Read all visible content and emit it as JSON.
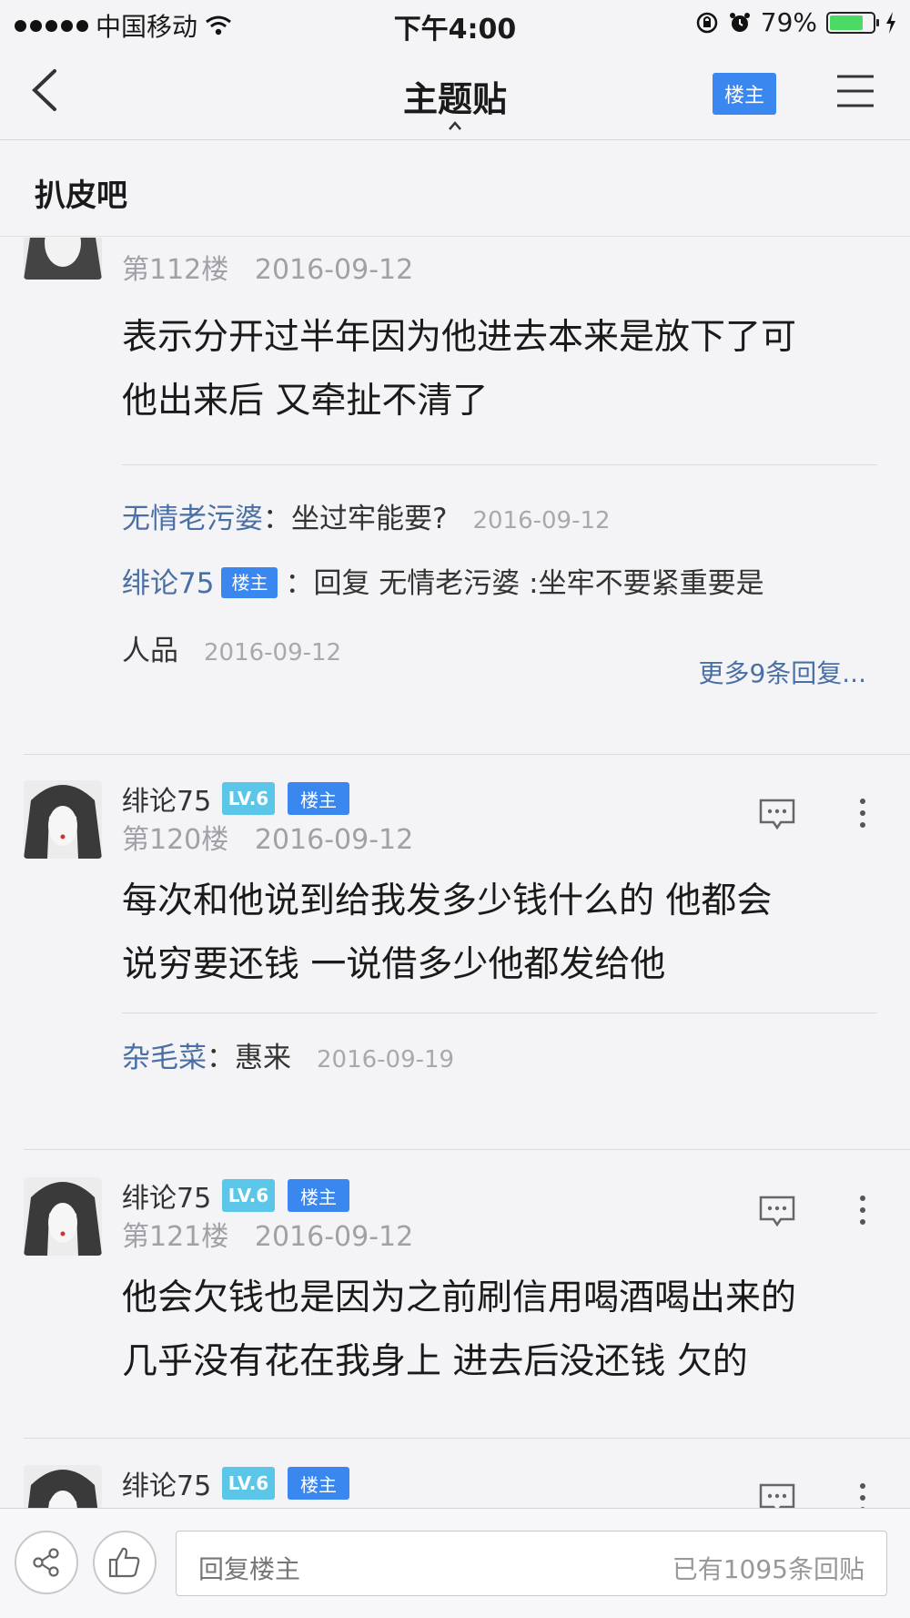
{
  "status_bar": {
    "carrier": "中国移动",
    "time": "下午4:00",
    "battery_percent": "79%",
    "battery_level": 0.79
  },
  "nav": {
    "title": "主题贴",
    "owner_button": "楼主"
  },
  "forum": {
    "name": "扒皮吧"
  },
  "posts": [
    {
      "floor": "第112楼",
      "date": "2016-09-12",
      "body_lines": [
        "表示分开过半年因为他进去本来是放下了可",
        "他出来后 又牵扯不清了"
      ],
      "comments": [
        {
          "user": "无情老污婆",
          "text": "：坐过牢能要?",
          "date": "2016-09-12"
        },
        {
          "user": "绯论75",
          "badge": "楼主",
          "text": "：回复 无情老污婆 :坐牢不要紧重要是",
          "text2": "人品",
          "date": "2016-09-12"
        }
      ],
      "more_replies": "更多9条回复..."
    },
    {
      "user": "绯论75",
      "level": "LV.6",
      "badge": "楼主",
      "floor": "第120楼",
      "date": "2016-09-12",
      "body_lines": [
        "每次和他说到给我发多少钱什么的 他都会",
        "说穷要还钱 一说借多少他都发给他"
      ],
      "comments": [
        {
          "user": "杂毛菜",
          "text": "：惠来",
          "date": "2016-09-19"
        }
      ]
    },
    {
      "user": "绯论75",
      "level": "LV.6",
      "badge": "楼主",
      "floor": "第121楼",
      "date": "2016-09-12",
      "body_lines": [
        "他会欠钱也是因为之前刷信用喝酒喝出来的",
        "几乎没有花在我身上 进去后没还钱 欠的"
      ]
    },
    {
      "user": "绯论75",
      "level": "LV.6",
      "badge": "楼主"
    }
  ],
  "bottom_bar": {
    "reply_placeholder": "回复楼主",
    "reply_count": "已有1095条回贴"
  },
  "colors": {
    "accent": "#3a87f0",
    "level_badge": "#5cc6e8",
    "link": "#4a6fa5",
    "battery": "#4cd964"
  }
}
